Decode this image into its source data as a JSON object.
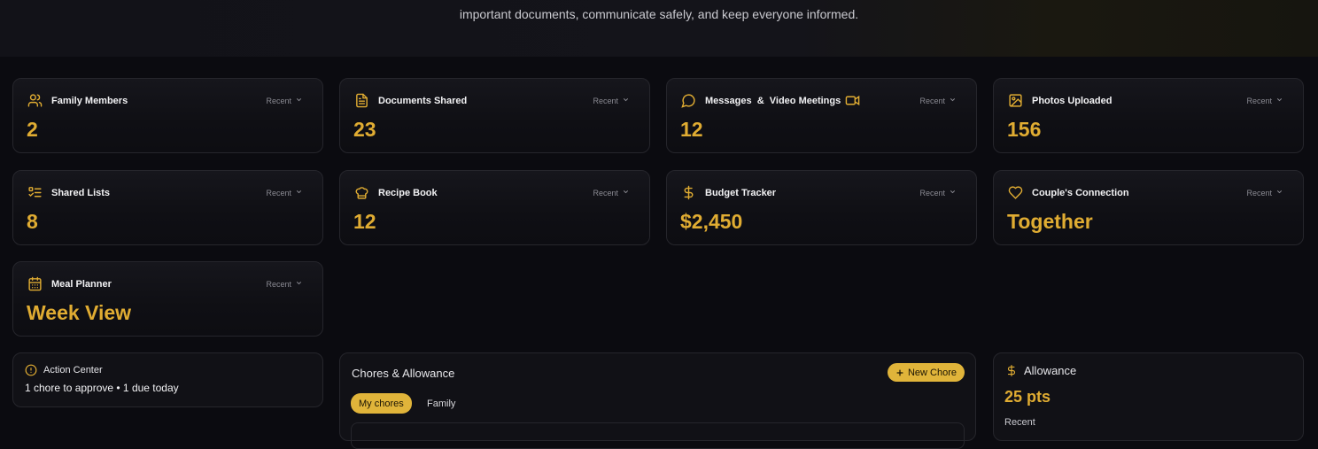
{
  "hero": {
    "text": "important documents, communicate safely, and keep everyone informed."
  },
  "cards": [
    {
      "title": "Family Members",
      "value": "2",
      "filter": "Recent",
      "icon": "users-icon"
    },
    {
      "title": "Documents Shared",
      "value": "23",
      "filter": "Recent",
      "icon": "document-icon"
    },
    {
      "title": "Messages  &  Video Meetings",
      "value": "12",
      "filter": "Recent",
      "icon": "chat-bubble-icon"
    },
    {
      "title": "Photos Uploaded",
      "value": "156",
      "filter": "Recent",
      "icon": "image-icon"
    },
    {
      "title": "Shared Lists",
      "value": "8",
      "filter": "Recent",
      "icon": "checklist-icon"
    },
    {
      "title": "Recipe Book",
      "value": "12",
      "filter": "Recent",
      "icon": "chef-hat-icon"
    },
    {
      "title": "Budget Tracker",
      "value": "$2,450",
      "filter": "Recent",
      "icon": "dollar-icon"
    },
    {
      "title": "Couple's Connection",
      "value": "Together",
      "filter": "Recent",
      "icon": "heart-icon"
    },
    {
      "title": "Meal Planner",
      "value": "Week View",
      "filter": "Recent",
      "icon": "calendar-icon"
    }
  ],
  "action_center": {
    "title": "Action Center",
    "summary": "1 chore to approve • 1 due today",
    "icon": "alert-circle-icon"
  },
  "chores": {
    "title": "Chores & Allowance",
    "new_button": "New Chore",
    "tabs": [
      "My chores",
      "Family"
    ],
    "active_tab": "My chores"
  },
  "allowance": {
    "title": "Allowance",
    "value": "25 pts",
    "sub": "Recent",
    "icon": "dollar-icon"
  },
  "colors": {
    "accent": "#e0ac32",
    "background": "#0b0b10",
    "card_border": "#26262c"
  }
}
